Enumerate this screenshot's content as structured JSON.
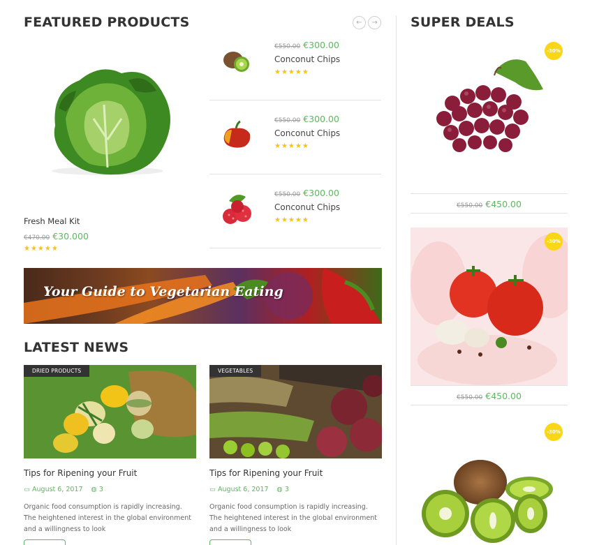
{
  "featured": {
    "title": "FEATURED PRODUCTS",
    "prev_icon": "←",
    "next_icon": "→",
    "main": {
      "name": "Fresh Meal Kit",
      "old_price": "€470.00",
      "new_price": "€30.000",
      "stars": "★★★★★"
    },
    "items": [
      {
        "old_price": "€550.00",
        "new_price": "€300.00",
        "name": "Conconut Chips",
        "stars": "★★★★★"
      },
      {
        "old_price": "€550.00",
        "new_price": "€300.00",
        "name": "Conconut Chips",
        "stars": "★★★★★"
      },
      {
        "old_price": "€550.00",
        "new_price": "€300.00",
        "name": "Conconut Chips",
        "stars": "★★★★★"
      }
    ]
  },
  "banner": {
    "text": "Your Guide to Vegetarian Eating"
  },
  "news": {
    "title": "LATEST NEWS",
    "cards": [
      {
        "tag": "DRIED PRODUCTS",
        "title": "Tips for Ripening your Fruit",
        "date": "August 6, 2017",
        "comments": "3",
        "excerpt": "Organic food consumption is rapidly increasing. The heightened interest in the global environment and a willingness to look"
      },
      {
        "tag": "VEGETABLES",
        "title": "Tips for Ripening your Fruit",
        "date": "August 6, 2017",
        "comments": "3",
        "excerpt": "Organic food consumption is rapidly increasing. The heightened interest in the global environment and a willingness to look"
      }
    ]
  },
  "deals": {
    "title": "SUPER DEALS",
    "items": [
      {
        "badge": "-30%",
        "old_price": "€550.00",
        "new_price": "€450.00"
      },
      {
        "badge": "-30%",
        "old_price": "€550.00",
        "new_price": "€450.00"
      },
      {
        "badge": "-30%"
      }
    ]
  },
  "colors": {
    "accent_green": "#5cb85c",
    "star_yellow": "#f4c316",
    "badge_yellow": "#f9d616",
    "heading": "#333333"
  }
}
